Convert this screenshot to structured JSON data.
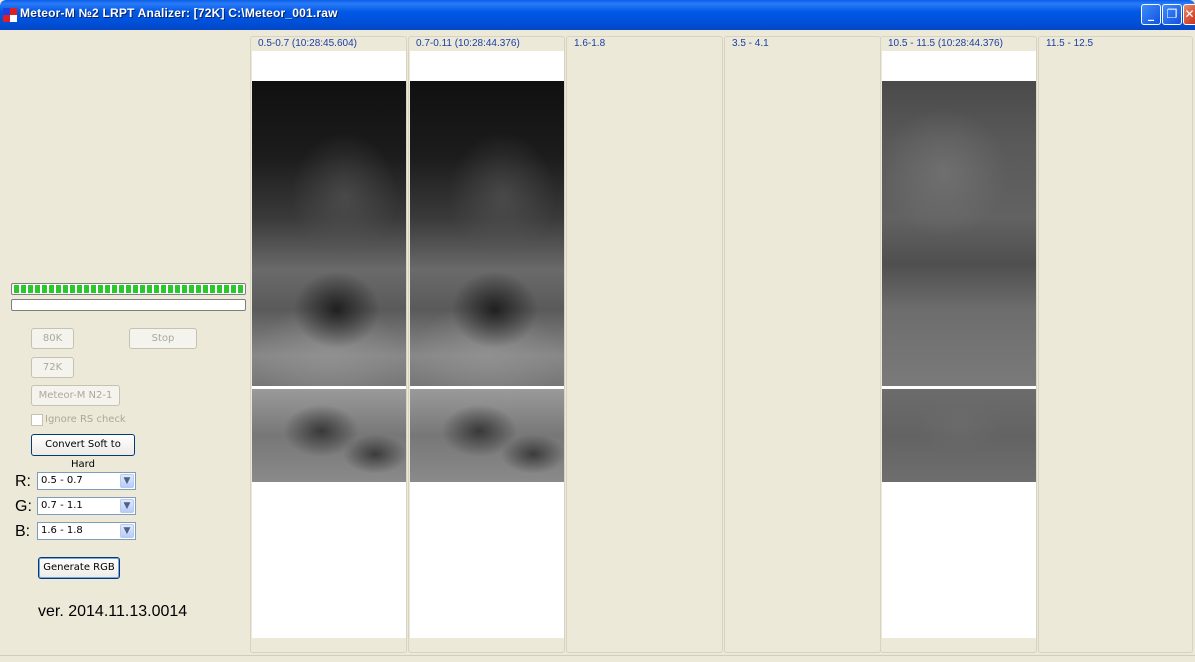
{
  "window": {
    "title": "Meteor-M №2 LRPT Analizer: [72K] C:\\Meteor_001.raw",
    "minimize_icon": "minimize-icon",
    "restore_icon": "restore-icon",
    "close_icon": "close-icon"
  },
  "progress": {
    "bar1_fraction": 1.0,
    "bar2_fraction": 0.0
  },
  "controls": {
    "btn_80k": "80K",
    "btn_stop": "Stop",
    "btn_72k": "72K",
    "btn_meteor": "Meteor-M N2-1",
    "ignore_rs_label": "Ignore RS check",
    "ignore_rs_checked": false,
    "convert_label": "Convert Soft to Hard",
    "generate_label": "Generate RGB"
  },
  "rgb": {
    "r_label": "R:",
    "r_value": "0.5 - 0.7",
    "g_label": "G:",
    "g_value": "0.7 - 1.1",
    "b_label": "B:",
    "b_value": "1.6 - 1.8"
  },
  "version": "ver. 2014.11.13.0014",
  "channels": [
    {
      "label": "0.5-0.7 (10:28:45.604)",
      "has_image": true
    },
    {
      "label": "0.7-0.11 (10:28:44.376)",
      "has_image": true
    },
    {
      "label": "1.6-1.8",
      "has_image": false
    },
    {
      "label": "3.5 - 4.1",
      "has_image": false
    },
    {
      "label": "10.5 - 11.5 (10:28:44.376)",
      "has_image": true
    },
    {
      "label": "11.5 - 12.5",
      "has_image": false
    }
  ],
  "colors": {
    "titlebar": "#0054e3",
    "window_bg": "#ece9d8",
    "progress_fill": "#2bc82b",
    "channel_label": "#1a3ea8"
  }
}
